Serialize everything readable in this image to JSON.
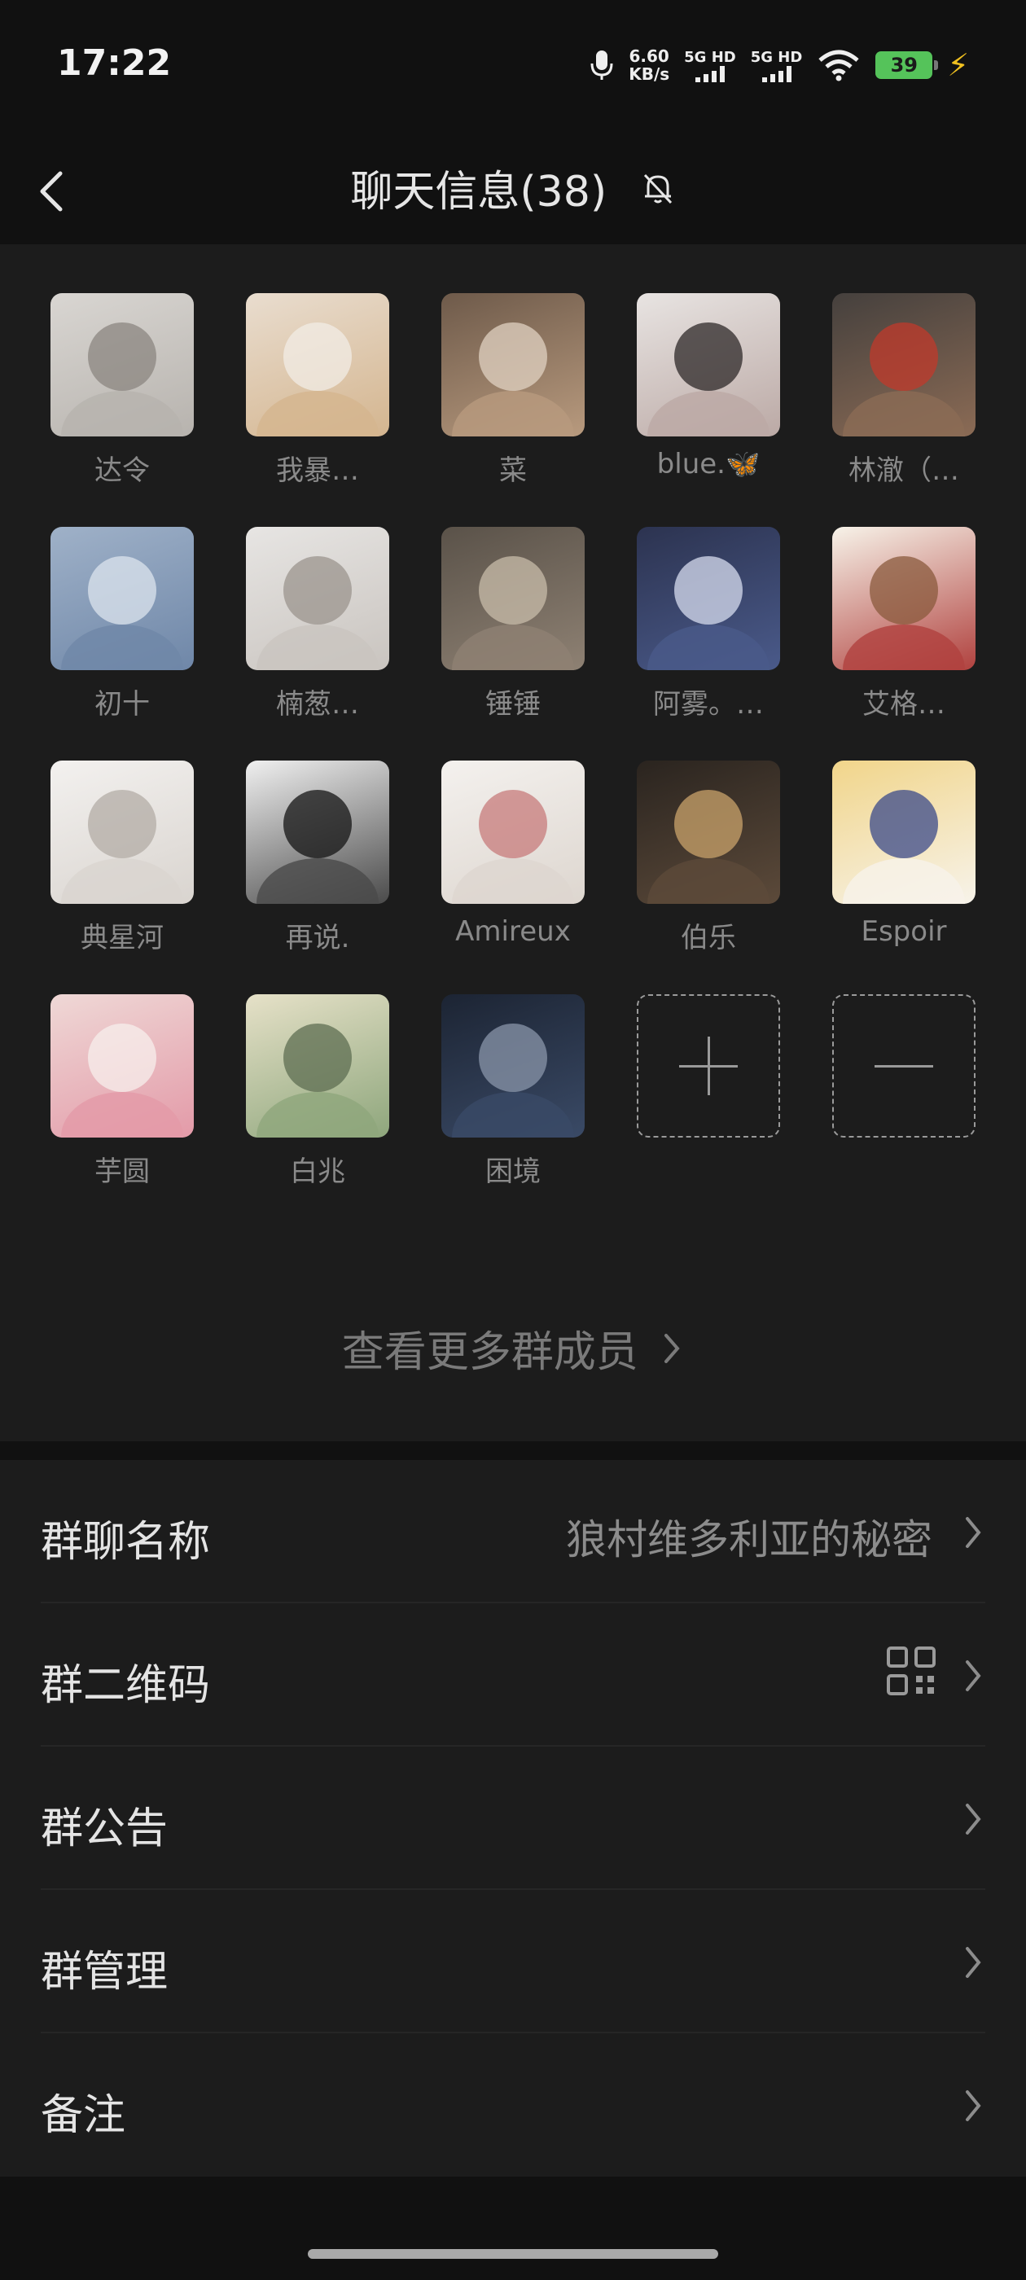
{
  "status_bar": {
    "time": "17:22",
    "net_speed_value": "6.60",
    "net_speed_unit": "KB/s",
    "sim1": "5G HD",
    "sim2": "5G HD",
    "battery": "39"
  },
  "header": {
    "title": "聊天信息(38)",
    "icons": [
      "back-chevron-icon",
      "bell-off-icon"
    ]
  },
  "members": [
    {
      "name": "达令",
      "colors": [
        "#d9d6d2",
        "#b7b3ae",
        "#8b8680"
      ]
    },
    {
      "name": "我暴…",
      "colors": [
        "#e9ddcf",
        "#d4b58f",
        "#f2ece6"
      ]
    },
    {
      "name": "菜",
      "colors": [
        "#6e5a4a",
        "#b89a7e",
        "#e0d2c2"
      ]
    },
    {
      "name": "blue.🦋",
      "colors": [
        "#e8e4e2",
        "#bba9a5",
        "#2e2828"
      ]
    },
    {
      "name": "林澈（…",
      "colors": [
        "#45403d",
        "#8b6b55",
        "#c0392b"
      ]
    },
    {
      "name": "初十",
      "colors": [
        "#9fb1c8",
        "#6f87a8",
        "#dce4ee"
      ]
    },
    {
      "name": "楠葱…",
      "colors": [
        "#e7e5e3",
        "#c9c4bf",
        "#9b948d"
      ]
    },
    {
      "name": "锤锤",
      "colors": [
        "#5a5249",
        "#8e8173",
        "#c8bca9"
      ]
    },
    {
      "name": "阿雾。…",
      "colors": [
        "#2c3350",
        "#4a5a8a",
        "#d7dcef"
      ]
    },
    {
      "name": "艾格…",
      "colors": [
        "#f7f3e9",
        "#b0413e",
        "#8a5a3c"
      ]
    },
    {
      "name": "典星河",
      "colors": [
        "#f3f1ef",
        "#d9d4cf",
        "#b3aca5"
      ]
    },
    {
      "name": "再说.",
      "colors": [
        "#f0f0f0",
        "#4a4a4a",
        "#141414"
      ]
    },
    {
      "name": "Amireux",
      "colors": [
        "#f4f1ee",
        "#ddd6cf",
        "#c77b7b"
      ]
    },
    {
      "name": "伯乐",
      "colors": [
        "#2a241f",
        "#5c4a3a",
        "#c9a36b"
      ]
    },
    {
      "name": "Espoir",
      "colors": [
        "#f1d58a",
        "#f7f3ea",
        "#3b4a8a"
      ]
    },
    {
      "name": "芋圆",
      "colors": [
        "#efd8d6",
        "#e39aa8",
        "#f7efec"
      ]
    },
    {
      "name": "白兆",
      "colors": [
        "#e6e1c8",
        "#8ea67c",
        "#5e6e52"
      ]
    },
    {
      "name": "困境",
      "colors": [
        "#1c2433",
        "#3a4a66",
        "#8a95aa"
      ]
    }
  ],
  "actions": {
    "add_icon": "plus-icon",
    "remove_icon": "minus-icon",
    "more_label": "查看更多群成员"
  },
  "settings": [
    {
      "label": "群聊名称",
      "value": "狼村维多利亚的秘密"
    },
    {
      "label": "群二维码",
      "value": ""
    },
    {
      "label": "群公告",
      "value": ""
    },
    {
      "label": "群管理",
      "value": ""
    },
    {
      "label": "备注",
      "value": ""
    }
  ]
}
